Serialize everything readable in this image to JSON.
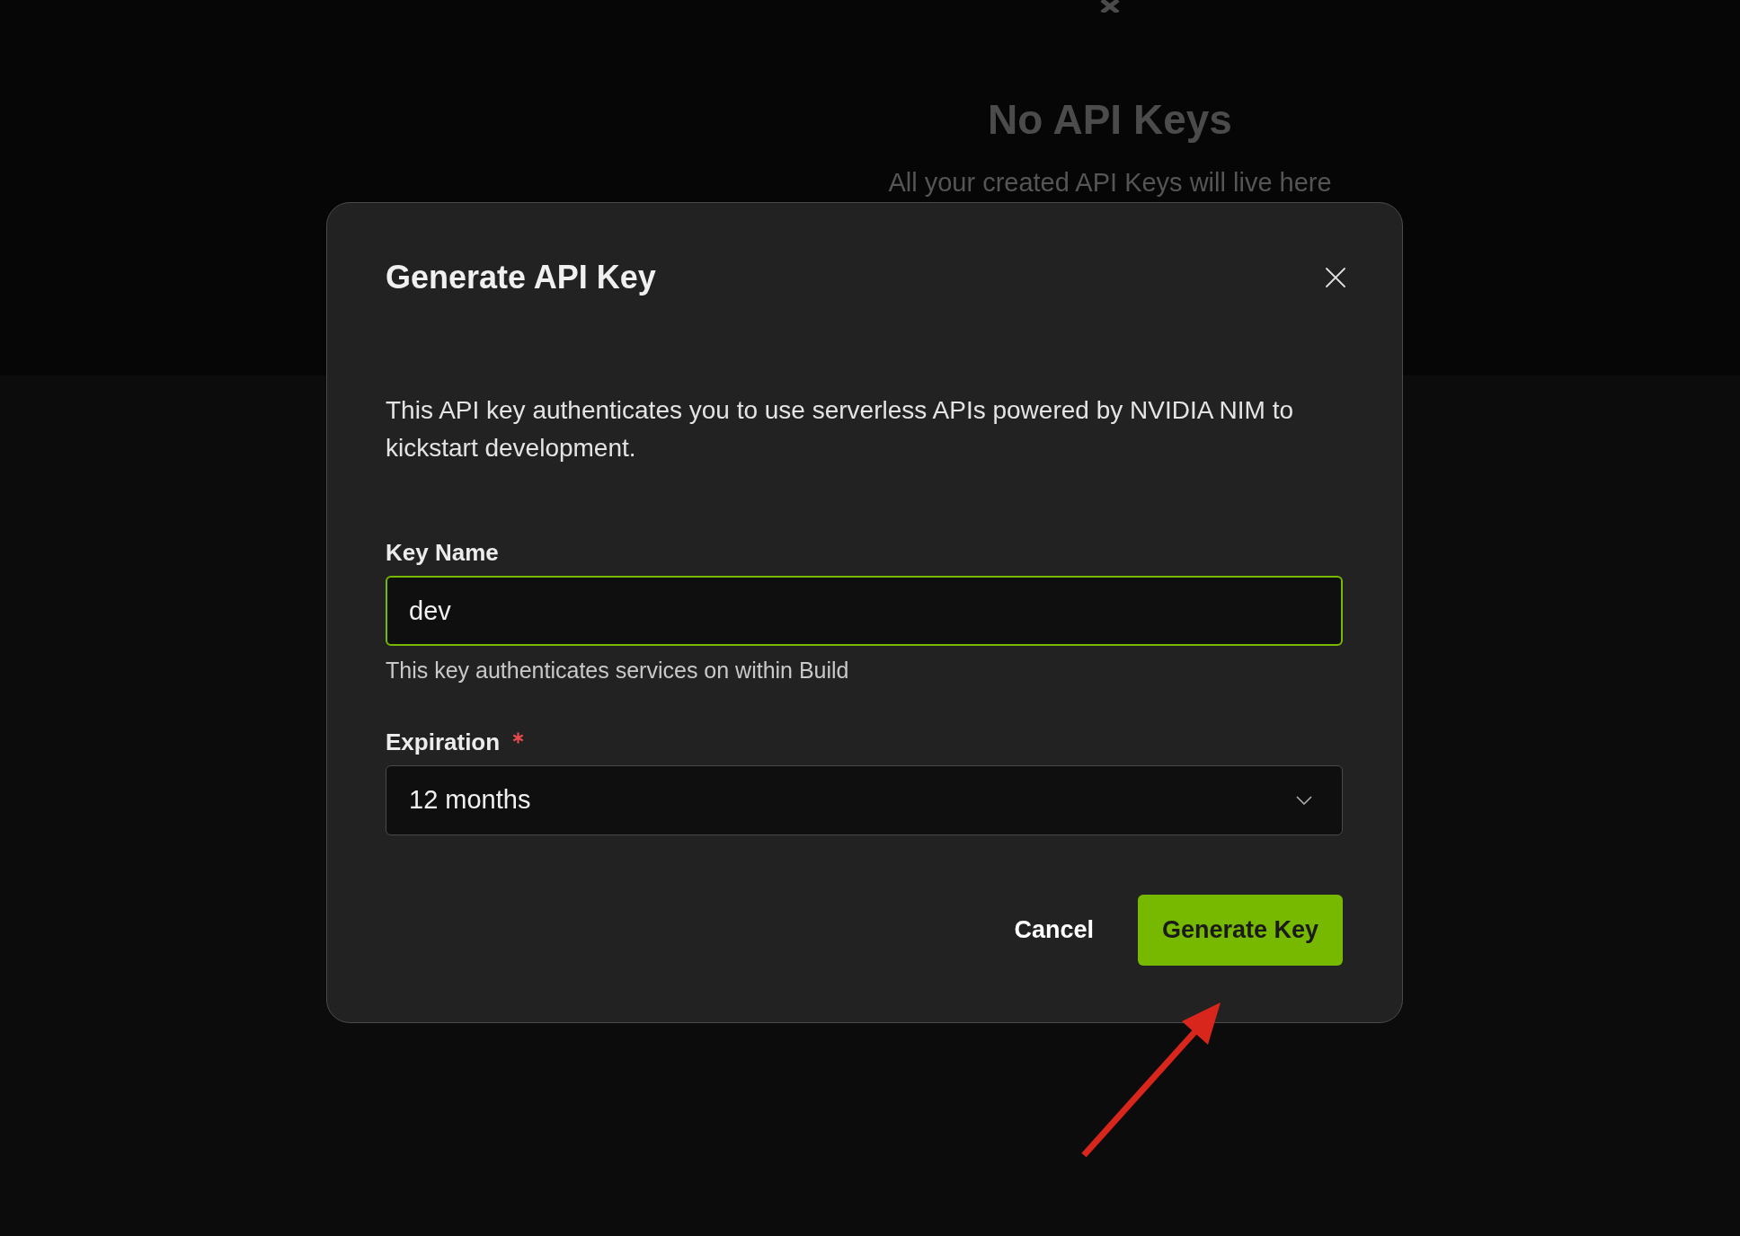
{
  "empty_state": {
    "title": "No API Keys",
    "message": "All your created API Keys will live here"
  },
  "dialog": {
    "title": "Generate API Key",
    "description": "This API key authenticates you to use serverless APIs powered by NVIDIA NIM to kickstart development.",
    "fields": [
      {
        "kind": "text",
        "label": "Key Name",
        "required": false,
        "value": "dev",
        "focused": true,
        "help": "This key authenticates services on within Build"
      },
      {
        "kind": "select",
        "label": "Expiration",
        "required": true,
        "value": "12 months",
        "focused": false
      }
    ],
    "buttons": [
      {
        "kind": "secondary",
        "label": "Cancel"
      },
      {
        "kind": "primary",
        "label": "Generate Key"
      }
    ]
  }
}
